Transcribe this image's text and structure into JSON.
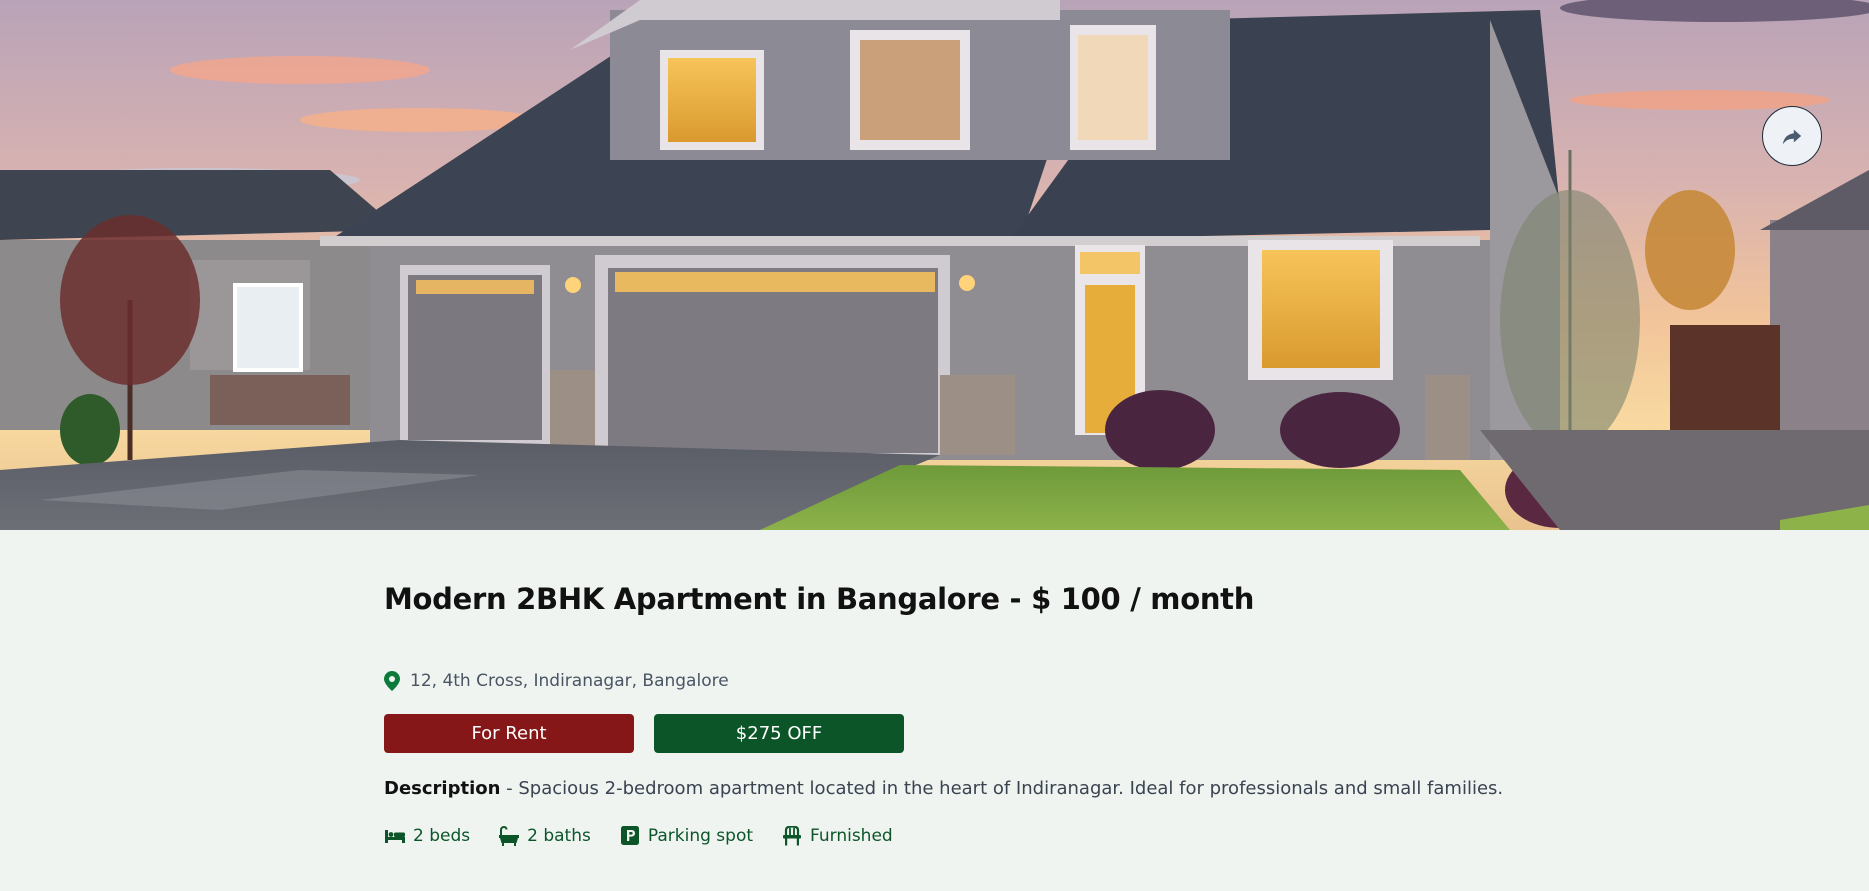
{
  "hero": {
    "image_alt": "House at sunset",
    "share_icon": "share-icon"
  },
  "listing": {
    "title": "Modern 2BHK Apartment in Bangalore - $ 100 / month",
    "address": "12, 4th Cross, Indiranagar, Bangalore",
    "address_icon": "map-pin-icon",
    "tags": {
      "status": "For Rent",
      "discount": "$275 OFF"
    },
    "description_label": "Description",
    "description_text": " - Spacious 2-bedroom apartment located in the heart of Indiranagar. Ideal for professionals and small families.",
    "features": [
      {
        "icon": "bed-icon",
        "label": "2 beds"
      },
      {
        "icon": "bath-icon",
        "label": "2 baths"
      },
      {
        "icon": "parking-icon",
        "label": "Parking spot"
      },
      {
        "icon": "chair-icon",
        "label": "Furnished"
      }
    ]
  },
  "colors": {
    "background": "#eff4f1",
    "rent_tag": "#861718",
    "discount_tag": "#0c5528",
    "feature_green": "#0c5528"
  }
}
